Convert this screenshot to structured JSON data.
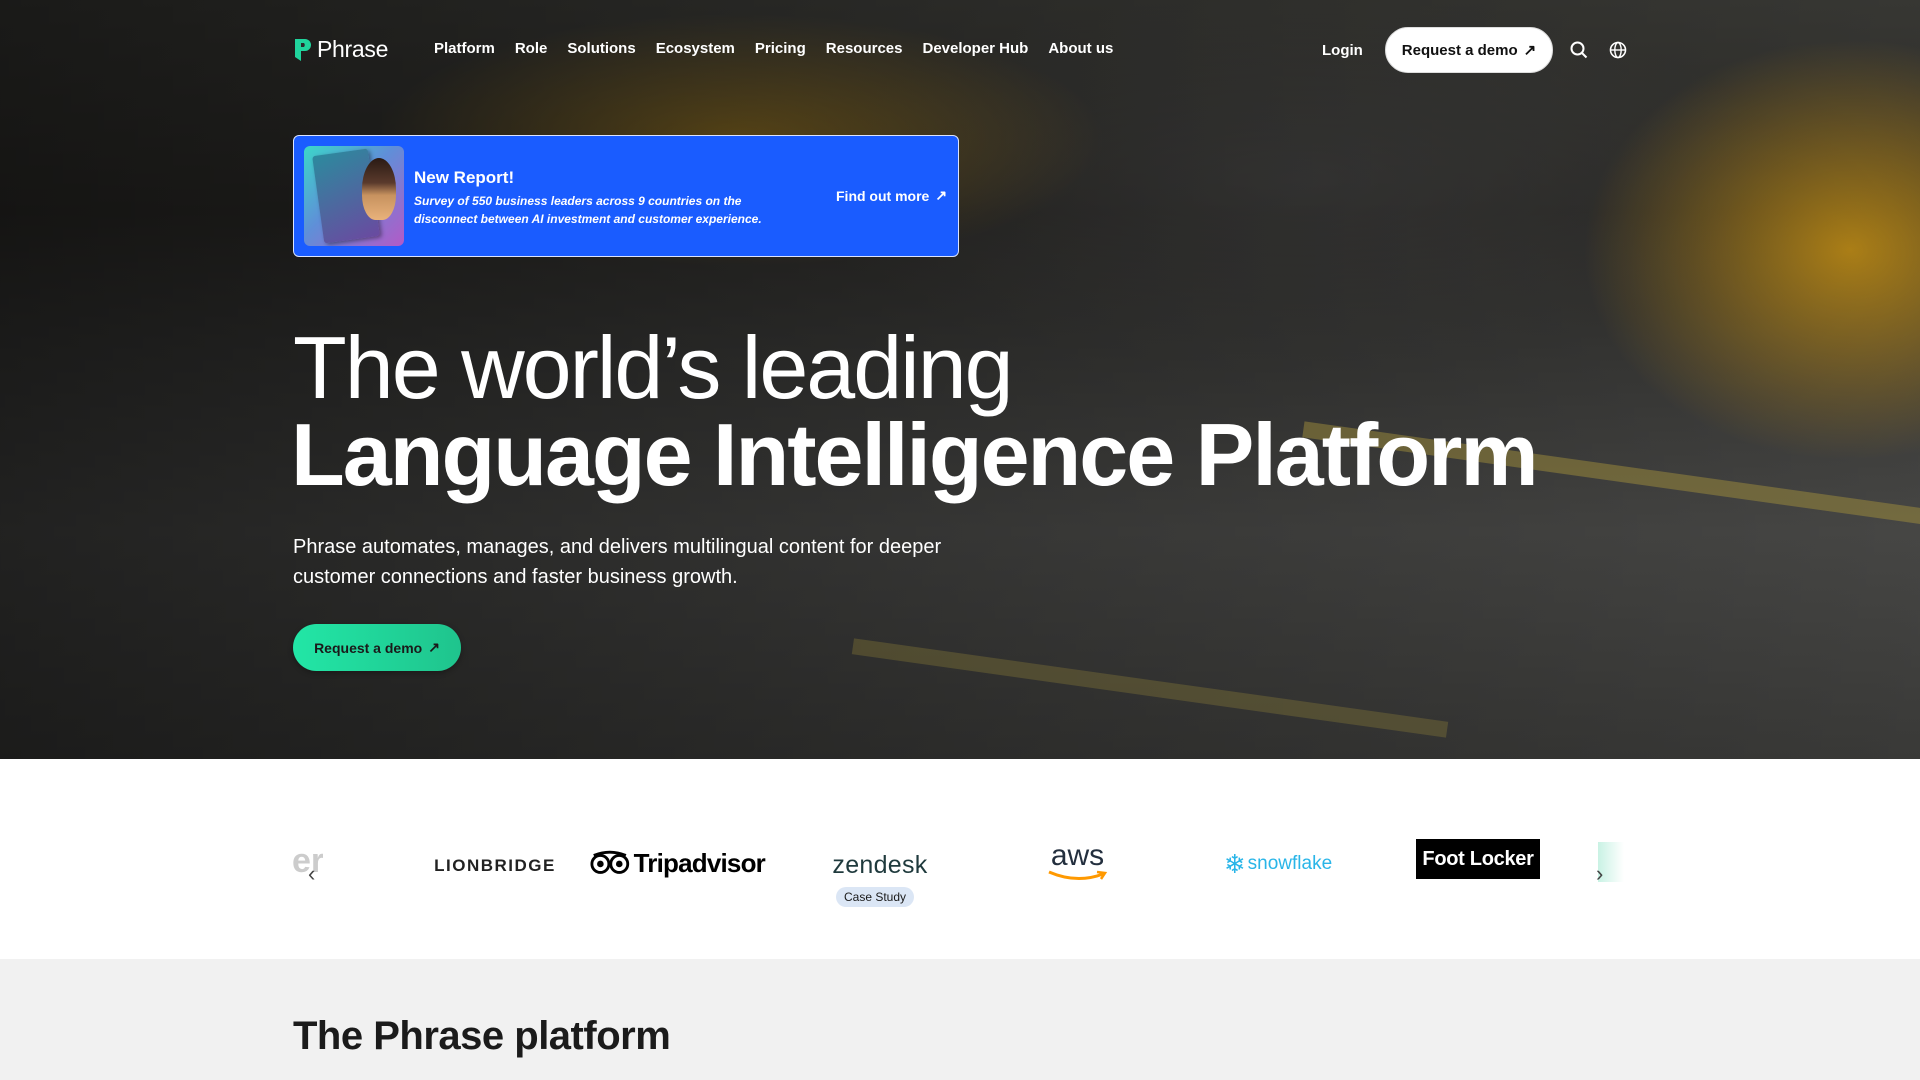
{
  "brand": {
    "name": "Phrase"
  },
  "nav": {
    "items": [
      "Platform",
      "Role",
      "Solutions",
      "Ecosystem",
      "Pricing",
      "Resources",
      "Developer Hub",
      "About us"
    ],
    "login": "Login",
    "demo": "Request a demo",
    "arrow": "↗"
  },
  "banner": {
    "title": "New Report!",
    "description": "Survey of 550 business leaders across 9 countries on the disconnect between AI investment and customer experience.",
    "link": "Find out more",
    "arrow": "↗"
  },
  "hero": {
    "headline_light": "The world’s leading",
    "headline_bold": "Language Intelligence Platform",
    "subtitle": "Phrase automates, manages, and delivers multilingual content for deeper customer connections and faster business growth.",
    "cta": "Request a demo",
    "arrow": "↗"
  },
  "customers": {
    "logos": [
      "LIONBRIDGE",
      "Tripadvisor",
      "zendesk",
      "aws",
      "snowflake",
      "Foot Locker"
    ],
    "partial_left": "er",
    "badge": "Case Study",
    "prev": "‹",
    "next": "›"
  },
  "section": {
    "title": "The Phrase platform"
  },
  "colors": {
    "accent_green": "#22e6a6",
    "banner_blue": "#1a5cff"
  }
}
